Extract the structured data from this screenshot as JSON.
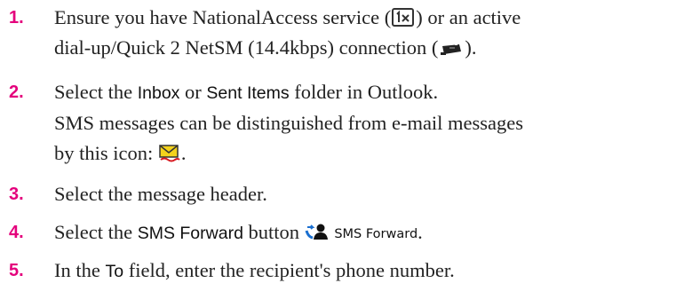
{
  "steps": [
    {
      "number": "1.",
      "line1_a": "Ensure you have NationalAccess service (",
      "line1_b": ") or an active",
      "line2_a": "dial-up/Quick 2 NetSM (14.4kbps) connection (",
      "line2_b": ").",
      "icons": [
        "1x-service-icon",
        "dialup-connection-icon"
      ]
    },
    {
      "number": "2.",
      "line1_a": "Select the ",
      "term1": "Inbox",
      "line1_b": " or ",
      "term2": "Sent Items",
      "line1_c": " folder in Outlook.",
      "line2": "SMS messages can be distinguished from e-mail messages",
      "line3_a": "by this icon: ",
      "line3_b": ".",
      "icons": [
        "sms-message-icon"
      ]
    },
    {
      "number": "3.",
      "text": "Select the message header."
    },
    {
      "number": "4.",
      "line1_a": "Select the ",
      "term": "SMS Forward",
      "line1_b": " button ",
      "button_label": "SMS Forward",
      "line1_c": ".",
      "icons": [
        "sms-forward-icon"
      ]
    },
    {
      "number": "5.",
      "line1_a": "In the ",
      "term": "To",
      "line1_b": " field, enter the recipient's phone number."
    }
  ],
  "colors": {
    "step_number": "#e4007c",
    "body_text": "#222222"
  }
}
